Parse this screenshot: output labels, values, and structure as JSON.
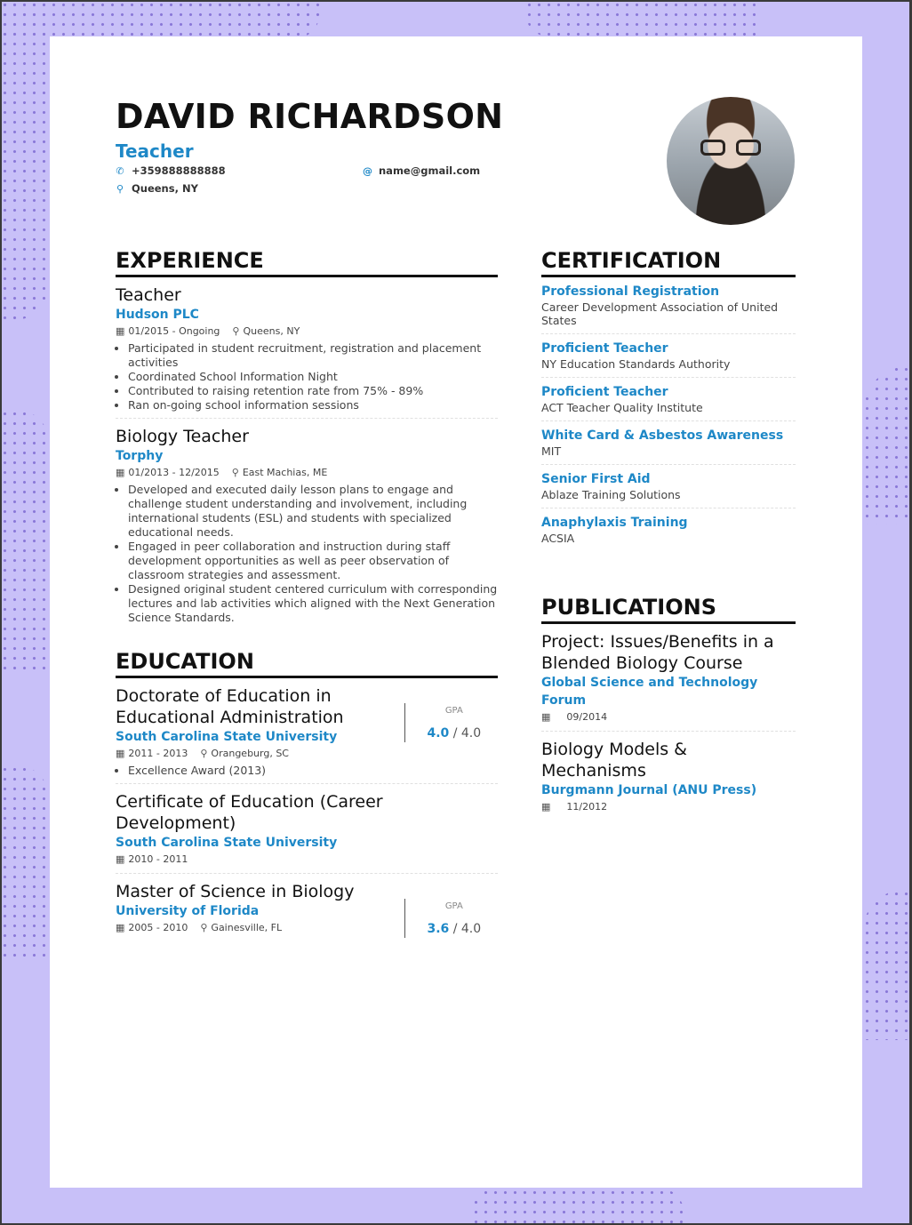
{
  "header": {
    "name": "DAVID RICHARDSON",
    "title": "Teacher",
    "phone": "+359888888888",
    "email": "name@gmail.com",
    "location": "Queens, NY",
    "icons": {
      "phone": "phone-icon",
      "email": "at-icon",
      "location": "map-pin-icon",
      "calendar": "calendar-icon"
    }
  },
  "experience": {
    "heading": "EXPERIENCE",
    "items": [
      {
        "role": "Teacher",
        "company": "Hudson PLC",
        "dates": "01/2015 - Ongoing",
        "location": "Queens, NY",
        "bullets": [
          "Participated in student recruitment, registration and placement activities",
          "Coordinated School Information Night",
          "Contributed to raising retention rate from 75% - 89%",
          "Ran on-going school information sessions"
        ]
      },
      {
        "role": "Biology Teacher",
        "company": "Torphy",
        "dates": "01/2013 - 12/2015",
        "location": "East Machias, ME",
        "bullets": [
          "Developed and executed daily lesson plans to engage and challenge student understanding and involvement, including international students (ESL) and students with specialized educational needs.",
          "Engaged in peer collaboration and instruction during staff development opportunities as well as peer observation of classroom strategies and assessment.",
          "Designed original student centered curriculum with corresponding lectures and lab activities which aligned with the Next Generation Science Standards."
        ]
      }
    ]
  },
  "education": {
    "heading": "EDUCATION",
    "gpa_label": "GPA",
    "items": [
      {
        "degree": "Doctorate of Education in Educational Administration",
        "school": "South Carolina State University",
        "dates": "2011 - 2013",
        "location": "Orangeburg, SC",
        "bullets": [
          "Excellence Award (2013)"
        ],
        "gpa": "4.0",
        "gpa_max": "4.0"
      },
      {
        "degree": "Certificate of Education (Career Development)",
        "school": "South Carolina State University",
        "dates": "2010 - 2011"
      },
      {
        "degree": "Master of Science in Biology",
        "school": "University of Florida",
        "dates": "2005 - 2010",
        "location": "Gainesville, FL",
        "gpa": "3.6",
        "gpa_max": "4.0"
      }
    ]
  },
  "certification": {
    "heading": "CERTIFICATION",
    "items": [
      {
        "title": "Professional Registration",
        "issuer": "Career Development Association of United States"
      },
      {
        "title": "Proficient Teacher",
        "issuer": "NY Education Standards Authority"
      },
      {
        "title": "Proficient Teacher",
        "issuer": "ACT Teacher Quality Institute"
      },
      {
        "title": "White Card & Asbestos Awareness",
        "issuer": "MIT"
      },
      {
        "title": "Senior First Aid",
        "issuer": "Ablaze Training Solutions"
      },
      {
        "title": "Anaphylaxis Training",
        "issuer": "ACSIA"
      }
    ]
  },
  "publications": {
    "heading": "PUBLICATIONS",
    "items": [
      {
        "title": "Project: Issues/Benefits in a Blended Biology Course",
        "publisher": "Global Science and Technology Forum",
        "date": "09/2014"
      },
      {
        "title": "Biology Models & Mechanisms",
        "publisher": "Burgmann Journal (ANU Press)",
        "date": "11/2012"
      }
    ]
  },
  "colors": {
    "accent": "#1e88c7",
    "background": "#c8c0f8",
    "dots": "#8a78d8"
  }
}
